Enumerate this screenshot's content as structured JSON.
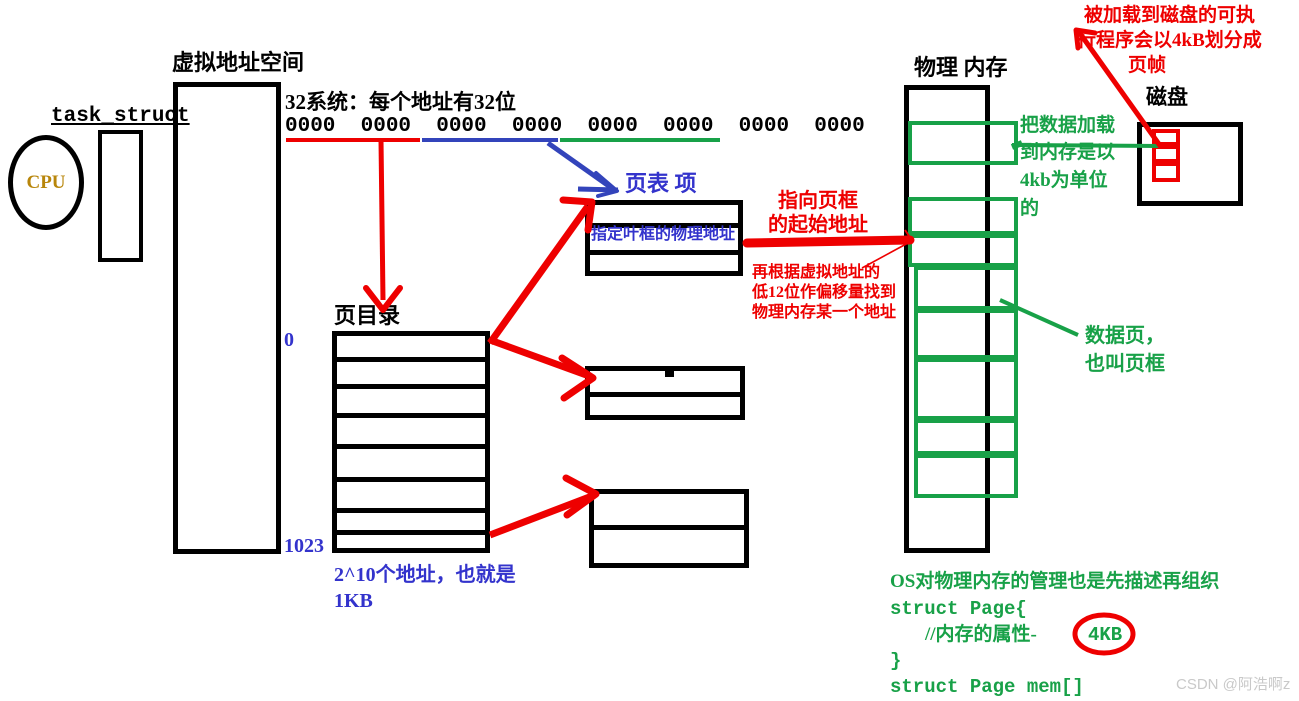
{
  "diagram": {
    "title_virtual_space": "虚拟地址空间",
    "title_physical_mem": "物理 内存",
    "title_disk": "磁盘",
    "title_page_dir": "页目录",
    "title_page_table_entry": "页表 项",
    "label_task_struct": "task_struct",
    "label_cpu": "CPU",
    "addr_line1": "32系统：每个地址有32位",
    "addr_bits": "0000  0000  0000  0000  0000  0000  0000  0000",
    "pte_row_text": "指定叶框的物理地址",
    "page_dir_index_top": "0",
    "page_dir_index_bottom": "1023",
    "page_dir_note_line1": "2^10个地址，也就是",
    "page_dir_note_line2": "1KB",
    "note_frame_start_line1": "指向页框",
    "note_frame_start_line2": "的起始地址",
    "note_offset_line1": "再根据虚拟地址的",
    "note_offset_line2": "低12位作偏移量找到",
    "note_offset_line3": "物理内存某一个地址",
    "note_load_4kb_line1": "把数据加载",
    "note_load_4kb_line2": "到内存是以",
    "note_load_4kb_line3": "4kb为单位",
    "note_load_4kb_line4": "的",
    "note_data_page_line1": "数据页，",
    "note_data_page_line2": "也叫页框",
    "note_disk_line1": "被加载到磁盘的可执",
    "note_disk_line2": "行程序会以4kB划分成",
    "note_disk_line3": "页帧",
    "os_note": "OS对物理内存的管理也是先描述再组织",
    "code_line1": "struct Page{",
    "code_line2": "//内存的属性-",
    "code_highlight": "4KB",
    "code_line3": "}",
    "code_line4": "struct Page mem[]",
    "watermark": "CSDN @阿浩啊z"
  },
  "colors": {
    "red": "#ee0000",
    "blue": "#3333cc",
    "green": "#18a148",
    "black": "#000000",
    "cpu_text": "#b8860b",
    "watermark": "#c9c9c9"
  }
}
